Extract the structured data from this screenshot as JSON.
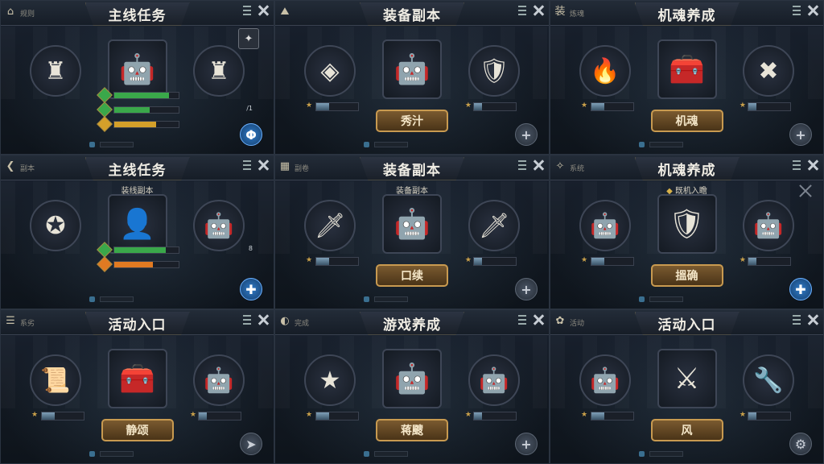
{
  "panels": [
    {
      "title": "主线任务",
      "left_label": "规则",
      "left_icon": "⌂",
      "subtitle": "",
      "button": "",
      "icons": [
        "♜",
        "🤖",
        "♜"
      ],
      "stats": [
        {
          "color": "#3aa84a",
          "fill": 0.85
        },
        {
          "color": "#3aa84a",
          "fill": 0.55,
          "num": "/1"
        },
        {
          "color": "#d4a02a",
          "fill": 0.65
        }
      ],
      "corner": "Φ",
      "corner_blue": true,
      "top_badge": "✦"
    },
    {
      "title": "装备副本",
      "left_label": "",
      "left_icon": "⛰",
      "subtitle": "",
      "button": "秀汁",
      "icons": [
        "◈",
        "🤖",
        "🛡"
      ],
      "corner": "+",
      "corner_blue": false
    },
    {
      "title": "机魂养成",
      "left_label": "炼魂",
      "left_icon": "装",
      "subtitle": "",
      "button": "机魂",
      "icons": [
        "🔥",
        "🧰",
        "✖"
      ],
      "corner": "+",
      "corner_blue": false
    },
    {
      "title": "主线任务",
      "left_label": "副本",
      "left_icon": "❮",
      "subtitle": "装线副本",
      "button": "",
      "icons": [
        "✪",
        "👤",
        "🤖"
      ],
      "stats": [
        {
          "color": "#3aa84a",
          "fill": 0.8,
          "num": "8"
        },
        {
          "color": "#e07a22",
          "fill": 0.6
        }
      ],
      "corner": "✚",
      "corner_blue": true
    },
    {
      "title": "装备副本",
      "left_label": "副卷",
      "left_icon": "▦",
      "subtitle": "装备副本",
      "button": "口续",
      "icons": [
        "🗡",
        "🤖",
        "🗡"
      ],
      "corner": "+",
      "corner_blue": false
    },
    {
      "title": "机魂养成",
      "left_label": "系统",
      "left_icon": "✧",
      "subtitle": "既机入瞻",
      "button": "搵确",
      "icons": [
        "🤖",
        "🛡",
        "🤖"
      ],
      "corner": "✚",
      "corner_blue": true,
      "subtitle_diamond": true,
      "cross": true
    },
    {
      "title": "活动入口",
      "left_label": "系劣",
      "left_icon": "☰",
      "subtitle": "",
      "button": "静颂",
      "icons": [
        "📜",
        "🧰",
        "🤖"
      ],
      "corner": "➤",
      "corner_blue": false
    },
    {
      "title": "游戏养成",
      "left_label": "完成",
      "left_icon": "◐",
      "subtitle": "",
      "button": "蒋颼",
      "icons": [
        "★",
        "🤖",
        "🤖"
      ],
      "corner": "+",
      "corner_blue": false
    },
    {
      "title": "活动入口",
      "left_label": "活动",
      "left_icon": "✿",
      "subtitle": "",
      "button": "风",
      "icons": [
        "🤖",
        "⚔",
        "🔧"
      ],
      "corner": "⚙",
      "corner_blue": false
    }
  ]
}
